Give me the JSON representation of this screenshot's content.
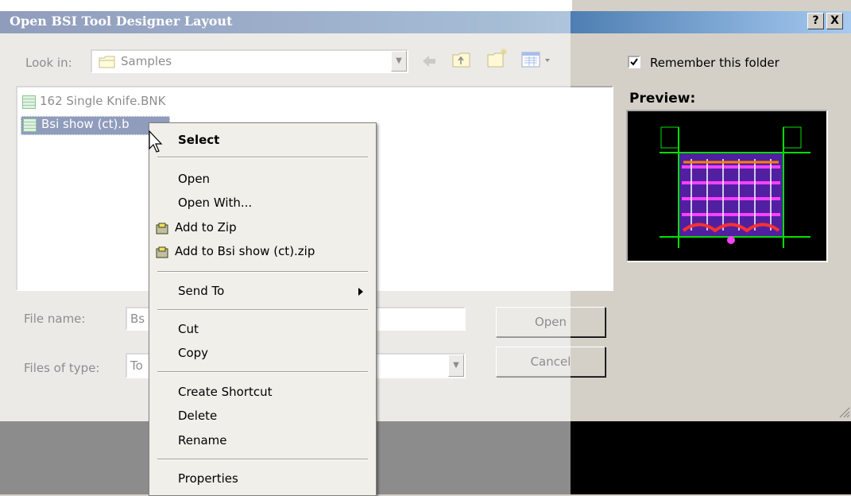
{
  "dialog": {
    "title": "Open BSI Tool Designer Layout",
    "help_label": "?",
    "close_label": "X",
    "look_in_label": "Look in:",
    "look_in_value": "Samples",
    "remember_label": "Remember this folder",
    "remember_checked": true,
    "preview_label": "Preview:",
    "file_name_label": "File name:",
    "file_name_value": "Bs",
    "files_of_type_label": "Files of type:",
    "files_of_type_value": "To",
    "open_button": "Open",
    "cancel_button": "Cancel",
    "files": [
      {
        "name": "162 Single Knife.BNK",
        "selected": false
      },
      {
        "name": "Bsi show (ct).bnk",
        "visible_text": "Bsi show (ct).b",
        "selected": true
      }
    ]
  },
  "context_menu": {
    "default_item": "Select",
    "group1": [
      "Open",
      "Open With...",
      "Add to Zip",
      "Add to Bsi show (ct).zip"
    ],
    "send_to": "Send To",
    "group3": [
      "Cut",
      "Copy"
    ],
    "group4": [
      "Create Shortcut",
      "Delete",
      "Rename"
    ],
    "properties": "Properties"
  },
  "colors": {
    "title_start": "#0a246a",
    "title_end": "#a6caf0",
    "selection": "#0a246a",
    "dialog_bg": "#d4d0c8"
  },
  "icons": [
    "folder-icon",
    "back-arrow-icon",
    "up-folder-icon",
    "new-folder-icon",
    "view-menu-icon",
    "file-icon",
    "zip-icon",
    "mouse-cursor-icon",
    "submenu-arrow-icon"
  ]
}
